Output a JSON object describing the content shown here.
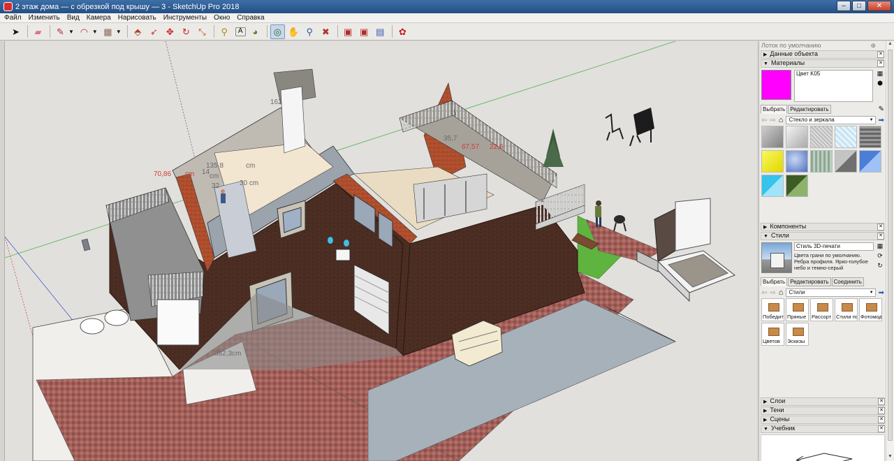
{
  "window": {
    "title": "2 этаж дома — с обрезкой под крышу — 3 - SketchUp Pro 2018",
    "minimize": "–",
    "maximize": "□",
    "close": "✕"
  },
  "menu": [
    "Файл",
    "Изменить",
    "Вид",
    "Камера",
    "Нарисовать",
    "Инструменты",
    "Окно",
    "Справка"
  ],
  "toolbar": {
    "tools": [
      {
        "name": "select-tool-icon",
        "glyph": "➤"
      },
      {
        "name": "eraser-tool-icon",
        "glyph": "▰"
      },
      {
        "name": "pencil-tool-icon",
        "glyph": "✎"
      },
      {
        "name": "arc-tool-icon",
        "glyph": "◠"
      },
      {
        "name": "rectangle-tool-icon",
        "glyph": "▦"
      },
      {
        "name": "push-pull-tool-icon",
        "glyph": "⬘"
      },
      {
        "name": "follow-me-tool-icon",
        "glyph": "➶"
      },
      {
        "name": "move-tool-icon",
        "glyph": "✥"
      },
      {
        "name": "rotate-tool-icon",
        "glyph": "↻"
      },
      {
        "name": "scale-tool-icon",
        "glyph": "⤡"
      },
      {
        "name": "tape-measure-tool-icon",
        "glyph": "⚲"
      },
      {
        "name": "text-tool-icon",
        "glyph": "A"
      },
      {
        "name": "paint-bucket-tool-icon",
        "glyph": "◕"
      },
      {
        "name": "orbit-tool-icon",
        "glyph": "◎"
      },
      {
        "name": "pan-tool-icon",
        "glyph": "✋"
      },
      {
        "name": "zoom-tool-icon",
        "glyph": "⚲"
      },
      {
        "name": "zoom-extents-tool-icon",
        "glyph": "✖"
      },
      {
        "name": "warehouse-icon",
        "glyph": "▣"
      },
      {
        "name": "extension-warehouse-icon",
        "glyph": "▣"
      },
      {
        "name": "share-model-icon",
        "glyph": "▤"
      },
      {
        "name": "extension-manager-icon",
        "glyph": "✿"
      }
    ]
  },
  "viewport": {
    "dimensions": [
      {
        "text": "162",
        "color": "gray"
      },
      {
        "text": "135,8",
        "color": "gray"
      },
      {
        "text": "cm",
        "color": "gray"
      },
      {
        "text": "70,86",
        "color": "red"
      },
      {
        "text": "cm",
        "color": "red"
      },
      {
        "text": "14",
        "color": "gray"
      },
      {
        "text": "cm",
        "color": "gray"
      },
      {
        "text": "32",
        "color": "gray"
      },
      {
        "text": "30 cm",
        "color": "gray"
      },
      {
        "text": "35,7",
        "color": "gray"
      },
      {
        "text": "67,57",
        "color": "red"
      },
      {
        "text": "22,6",
        "color": "red"
      },
      {
        "text": "882,3cm",
        "color": "gray"
      }
    ]
  },
  "tray": {
    "title": "Лоток по умолчанию",
    "pin": "⊕",
    "panels": {
      "entity_info": "Данные объекта",
      "materials": "Материалы",
      "components": "Компоненты",
      "styles": "Стили",
      "layers": "Слои",
      "shadows": "Тени",
      "scenes": "Сцены",
      "tutorial": "Учебник"
    },
    "materials": {
      "current_name": "Цвет K05",
      "current_color": "#ff00ff",
      "tab_select": "Выбрать",
      "tab_edit": "Редактировать",
      "library": "Стекло и зеркала",
      "swatches": [
        "#9b9b9b",
        "#cfcfcf",
        "#bdbdbd",
        "#c7e4f4",
        "#7a7a7a",
        "#f4f033",
        "#6b8fd8",
        "#9fb5a5",
        "#8a8a8a",
        "#6f9de0",
        "#37c3ea",
        "#5e7a3b"
      ]
    },
    "styles": {
      "current_name": "Стиль 3D-печати",
      "description": "Цвета грани по умолчанию. Ребра профиля. Ярко-голубое небо и темно-серый",
      "tab_select": "Выбрать",
      "tab_edit": "Редактировать",
      "tab_mix": "Соединить",
      "library": "Стили",
      "folders": [
        "Победит",
        "Пряные",
        "Рассорт",
        "Стили по",
        "Фотомод",
        "Цветов",
        "Эскизы"
      ]
    }
  }
}
